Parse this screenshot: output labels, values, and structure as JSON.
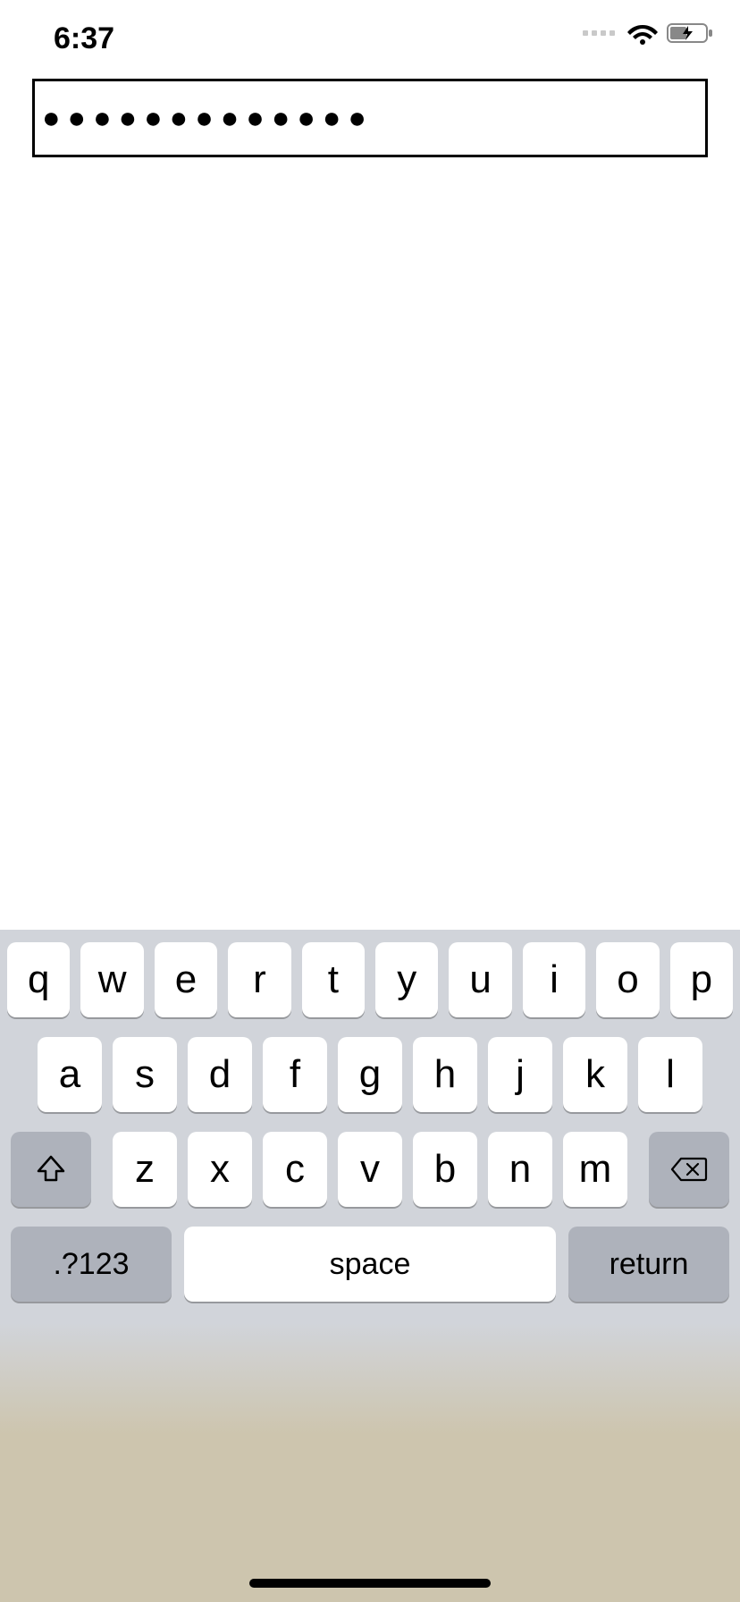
{
  "status": {
    "time": "6:37"
  },
  "input": {
    "value": "●●●●●●●●●●●●●"
  },
  "keyboard": {
    "row1": [
      "q",
      "w",
      "e",
      "r",
      "t",
      "y",
      "u",
      "i",
      "o",
      "p"
    ],
    "row2": [
      "a",
      "s",
      "d",
      "f",
      "g",
      "h",
      "j",
      "k",
      "l"
    ],
    "row3": [
      "z",
      "x",
      "c",
      "v",
      "b",
      "n",
      "m"
    ],
    "numkey": ".?123",
    "space": "space",
    "return": "return"
  }
}
